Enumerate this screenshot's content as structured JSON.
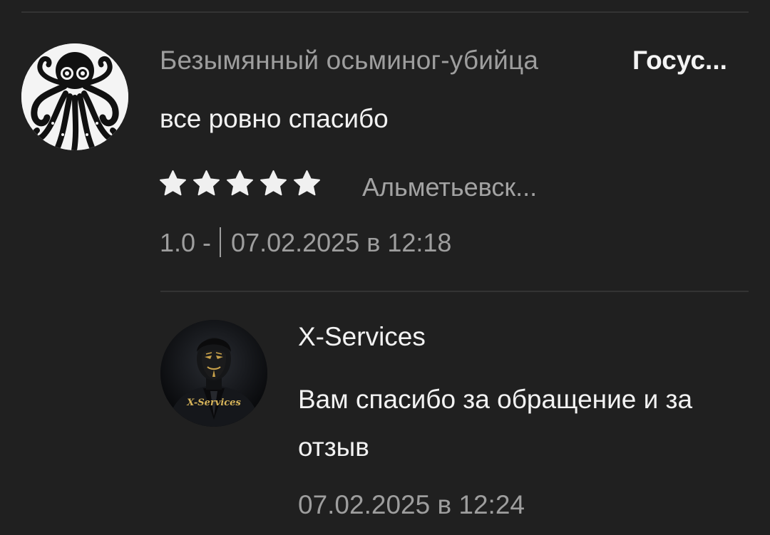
{
  "review": {
    "author": "Безымянный осьминог-убийца",
    "service_tag": "Госус...",
    "text": "все ровно спасибо",
    "rating": 5,
    "rating_max": 5,
    "city": "Альметьевск...",
    "version": "1.0 -",
    "date": "07.02.2025 в 12:18"
  },
  "reply": {
    "author": "X-Services",
    "text": "Вам спасибо за обращение и за отзыв",
    "date": "07.02.2025 в 12:24",
    "avatar_label": "X-Services"
  },
  "icons": {
    "author_avatar": "octopus-avatar-icon",
    "reply_avatar": "masked-man-avatar-icon",
    "star": "star-icon"
  },
  "colors": {
    "background": "#202020",
    "text_primary": "#f2f2f2",
    "text_secondary": "#9e9e9e",
    "star": "#f0f0f0",
    "divider": "#333333"
  }
}
